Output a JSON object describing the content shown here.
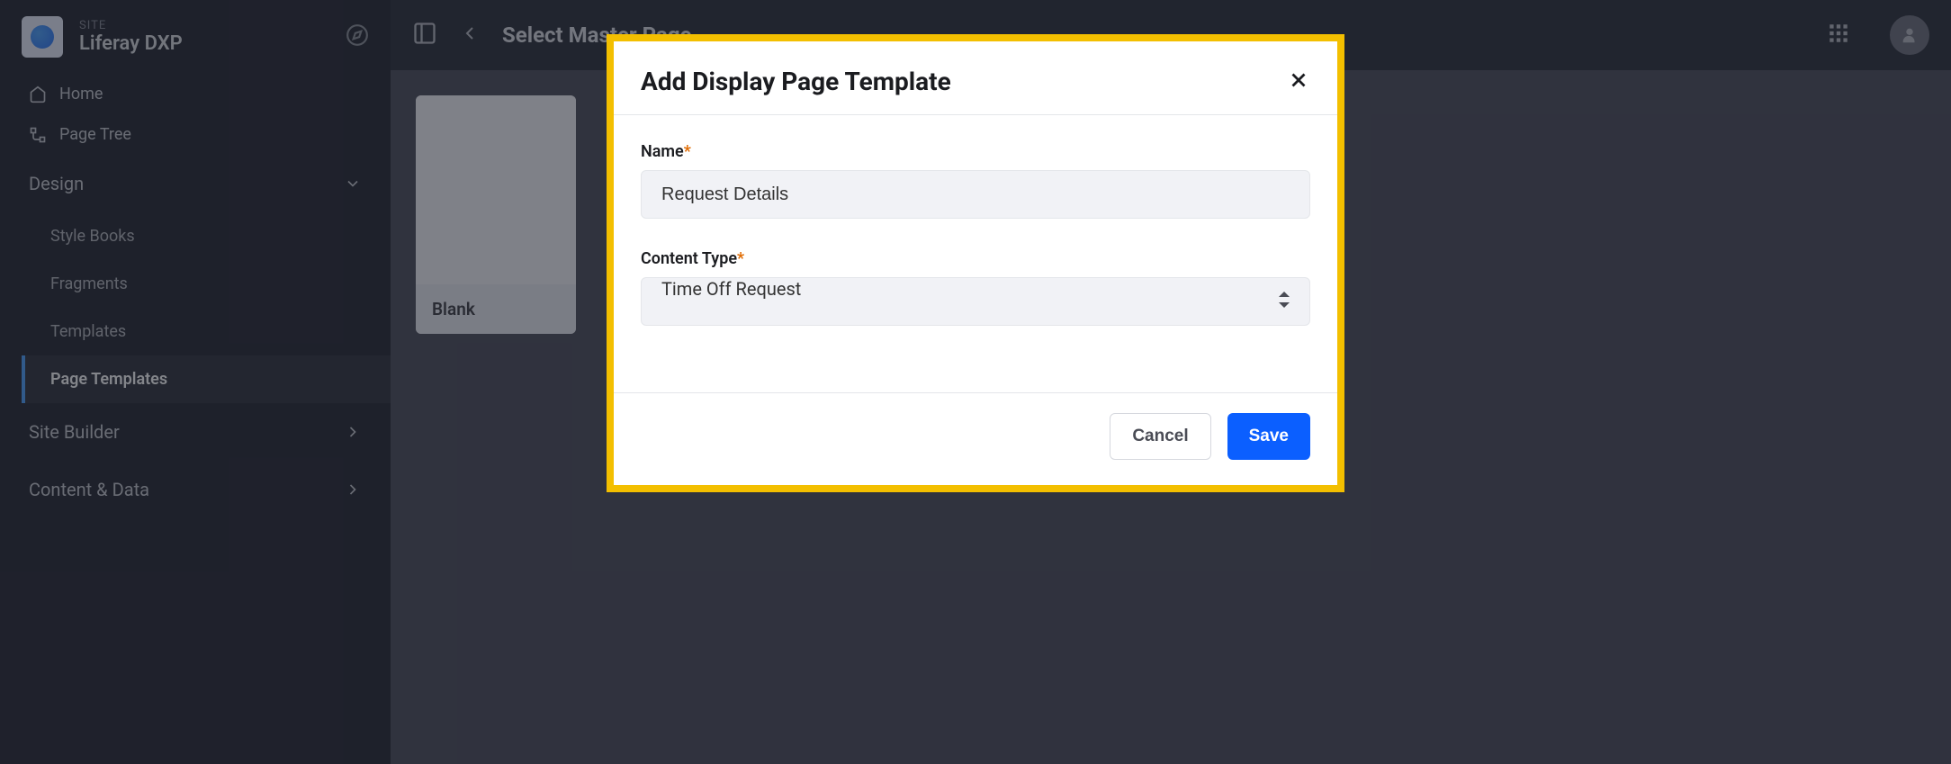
{
  "site": {
    "label": "SITE",
    "name": "Liferay DXP"
  },
  "nav": {
    "home": "Home",
    "page_tree": "Page Tree",
    "sections": {
      "design": {
        "label": "Design",
        "items": [
          "Style Books",
          "Fragments",
          "Templates",
          "Page Templates"
        ],
        "active_index": 3
      },
      "site_builder": {
        "label": "Site Builder"
      },
      "content_data": {
        "label": "Content & Data"
      }
    }
  },
  "topbar": {
    "title": "Select Master Page"
  },
  "content": {
    "card_label": "Blank"
  },
  "modal": {
    "title": "Add Display Page Template",
    "name_label": "Name",
    "name_value": "Request Details",
    "content_type_label": "Content Type",
    "content_type_value": "Time Off Request",
    "cancel": "Cancel",
    "save": "Save"
  }
}
